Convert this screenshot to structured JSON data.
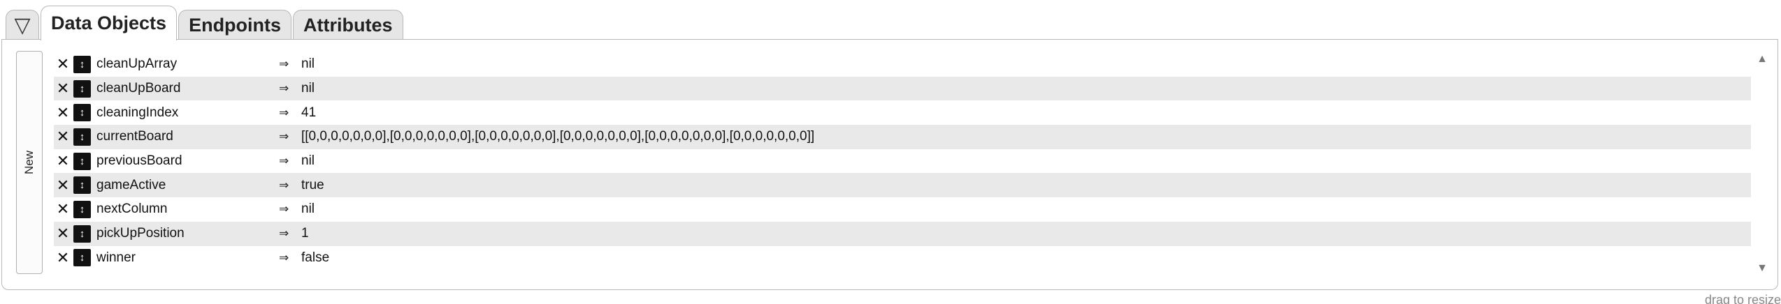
{
  "tabs": {
    "collapse_glyph": "▽",
    "items": [
      {
        "label": "Data Objects",
        "active": true
      },
      {
        "label": "Endpoints",
        "active": false
      },
      {
        "label": "Attributes",
        "active": false
      }
    ]
  },
  "panel": {
    "new_label": "New",
    "arrow_glyph": "⇒",
    "delete_glyph": "✕",
    "drag_glyph": "↕",
    "scroll_up_glyph": "▲",
    "scroll_down_glyph": "▼",
    "rows": [
      {
        "name": "cleanUpArray",
        "value": "nil"
      },
      {
        "name": "cleanUpBoard",
        "value": "nil"
      },
      {
        "name": "cleaningIndex",
        "value": "41"
      },
      {
        "name": "currentBoard",
        "value": "[[0,0,0,0,0,0,0],[0,0,0,0,0,0,0],[0,0,0,0,0,0,0],[0,0,0,0,0,0,0],[0,0,0,0,0,0,0],[0,0,0,0,0,0,0]]"
      },
      {
        "name": "previousBoard",
        "value": "nil"
      },
      {
        "name": "gameActive",
        "value": "true"
      },
      {
        "name": "nextColumn",
        "value": "nil"
      },
      {
        "name": "pickUpPosition",
        "value": "1"
      },
      {
        "name": "winner",
        "value": "false"
      }
    ]
  },
  "footer": {
    "resize_hint": "drag to resize"
  }
}
